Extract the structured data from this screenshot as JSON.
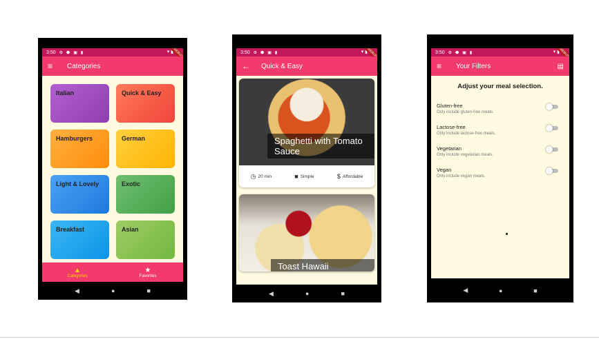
{
  "status_time": "3:50",
  "debug_label": "DEBUG",
  "phone1": {
    "appbar_title": "Categories",
    "categories": [
      {
        "label": "Italian",
        "color": "#a450c4"
      },
      {
        "label": "Quick & Easy",
        "color": "#f75a46"
      },
      {
        "label": "Hamburgers",
        "color": "#ff9a1a"
      },
      {
        "label": "German",
        "color": "#ffc21a"
      },
      {
        "label": "Light & Lovely",
        "color": "#2f8ce8"
      },
      {
        "label": "Exotic",
        "color": "#5aae5e"
      },
      {
        "label": "Breakfast",
        "color": "#1ea5ee"
      },
      {
        "label": "Asian",
        "color": "#86c25a"
      }
    ],
    "bottom_nav": {
      "categories_label": "Categories",
      "favorites_label": "Favorites"
    }
  },
  "phone2": {
    "appbar_title": "Quick & Easy",
    "meals": [
      {
        "title": "Spaghetti with Tomato Sauce",
        "duration": "20 min",
        "complexity": "Simple",
        "affordability": "Affordable"
      },
      {
        "title": "Toast Hawaii"
      }
    ]
  },
  "phone3": {
    "appbar_title": "Your Filters",
    "heading": "Adjust your meal selection.",
    "filters": [
      {
        "title": "Gluten-free",
        "subtitle": "Only include gluten-free meals."
      },
      {
        "title": "Lactose-free",
        "subtitle": "Only include lactose-free meals."
      },
      {
        "title": "Vegetarian",
        "subtitle": "Only include vegetarian meals."
      },
      {
        "title": "Vegan",
        "subtitle": "Only include vegan meals."
      }
    ]
  },
  "colors": {
    "appbar": "#f23a6d",
    "statusbar": "#c2185b",
    "background": "#fffbe0",
    "active_nav": "#ffd600"
  },
  "icons": {
    "menu": "menu-icon",
    "back": "arrow-back-icon",
    "save": "save-icon",
    "clock": "clock-icon",
    "work": "briefcase-icon",
    "money": "dollar-icon",
    "category": "category-icon",
    "star": "star-icon"
  }
}
